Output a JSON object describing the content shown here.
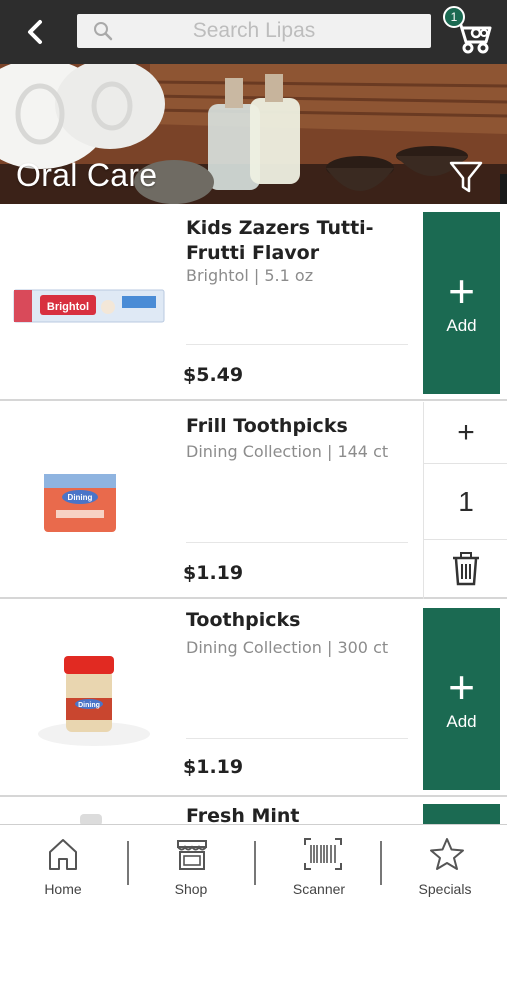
{
  "search": {
    "placeholder": "Search Lipas"
  },
  "cart": {
    "count": "1"
  },
  "banner": {
    "title": "Oral Care"
  },
  "products": [
    {
      "name": "Kids Zazers Tutti-Frutti Flavor",
      "meta": "Brightol | 5.1 oz",
      "price": "$5.49",
      "action": "Add",
      "image_label": "Brightol"
    },
    {
      "name": "Frill Toothpicks",
      "meta": "Dining Collection | 144 ct",
      "price": "$1.19",
      "quantity": "1",
      "image_label": "Dining"
    },
    {
      "name": "Toothpicks",
      "meta": "Dining Collection | 300 ct",
      "price": "$1.19",
      "action": "Add",
      "image_label": "Dining"
    },
    {
      "name": "Fresh Mint"
    }
  ],
  "nav": [
    {
      "label": "Home",
      "icon": "home-icon"
    },
    {
      "label": "Shop",
      "icon": "shop-icon"
    },
    {
      "label": "Scanner",
      "icon": "barcode-icon"
    },
    {
      "label": "Specials",
      "icon": "star-icon"
    }
  ],
  "colors": {
    "accent": "#1b6a52",
    "topbar": "#2d2d2d"
  }
}
